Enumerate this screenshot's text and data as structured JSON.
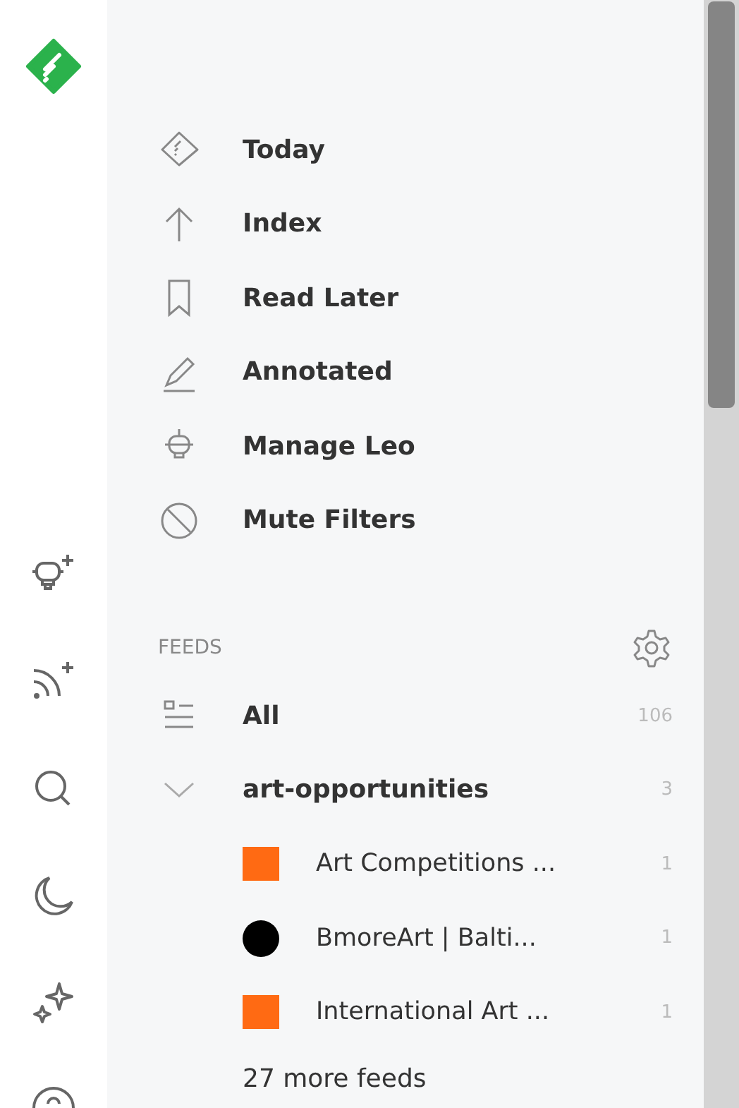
{
  "nav": [
    {
      "label": "Today",
      "kind": "today"
    },
    {
      "label": "Index",
      "kind": "index"
    },
    {
      "label": "Read Later",
      "kind": "bookmark"
    },
    {
      "label": "Annotated",
      "kind": "pen"
    },
    {
      "label": "Manage Leo",
      "kind": "robot"
    },
    {
      "label": "Mute Filters",
      "kind": "mute"
    }
  ],
  "feeds": {
    "heading": "FEEDS",
    "all": {
      "label": "All",
      "count": "106"
    },
    "folders": [
      {
        "label": "art-opportunities",
        "count": "3",
        "expanded": true,
        "children": [
          {
            "label": "Art Competitions ...",
            "count": "1",
            "kind": "square",
            "color": "#ff6a13"
          },
          {
            "label": "BmoreArt | Balti...",
            "count": "1",
            "kind": "circle",
            "color": "#000000"
          },
          {
            "label": "International Art ...",
            "count": "1",
            "kind": "square",
            "color": "#ff6a13"
          }
        ]
      }
    ],
    "more": "27 more feeds"
  }
}
